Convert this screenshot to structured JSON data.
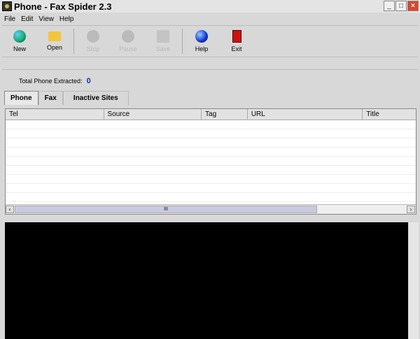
{
  "window": {
    "title": "Phone - Fax Spider 2.3"
  },
  "menu": [
    "File",
    "Edit",
    "View",
    "Help"
  ],
  "toolbar": {
    "new": "New",
    "open": "Open",
    "stop": "Stop",
    "pause": "Pause",
    "save": "Save",
    "help": "Help",
    "exit": "Exit"
  },
  "status": {
    "label": "Total Phone Extracted:",
    "value": "0"
  },
  "tabs": [
    "Phone",
    "Fax",
    "Inactive Sites"
  ],
  "table": {
    "columns": [
      "Tel",
      "Source",
      "Tag",
      "URL",
      "Title"
    ]
  },
  "scroll": {
    "thumb": "III"
  }
}
